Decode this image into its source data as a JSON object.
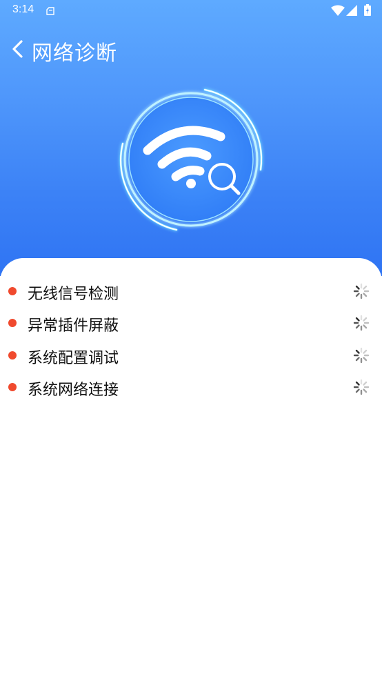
{
  "status_bar": {
    "time": "3:14",
    "icons": [
      "notification-icon",
      "wifi-icon",
      "cell-signal-icon",
      "battery-icon"
    ]
  },
  "header": {
    "title": "网络诊断",
    "back_icon": "chevron-left-icon"
  },
  "hero": {
    "icon": "wifi-search-icon",
    "colors": {
      "ring": "#cfeeff",
      "glow": "#39d3ff",
      "circle_fill": "#3b8cff"
    }
  },
  "diagnostics": {
    "items": [
      {
        "label": "无线信号检测",
        "status_icon": "loading-spinner-icon"
      },
      {
        "label": "异常插件屏蔽",
        "status_icon": "loading-spinner-icon"
      },
      {
        "label": "系统配置调试",
        "status_icon": "loading-spinner-icon"
      },
      {
        "label": "系统网络连接",
        "status_icon": "loading-spinner-icon"
      }
    ]
  },
  "colors": {
    "header_top": "#5eaaff",
    "header_bottom": "#2f74f3",
    "bullet": "#f04a2e",
    "text": "#111111"
  }
}
